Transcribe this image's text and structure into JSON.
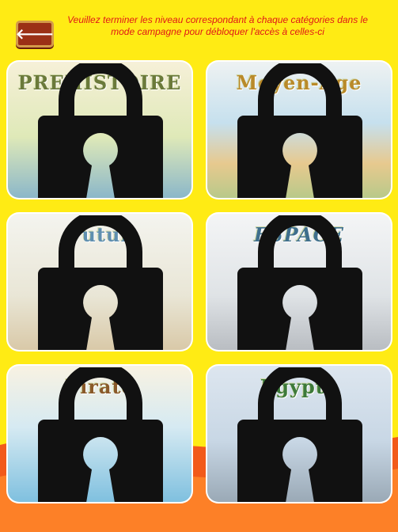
{
  "header": {
    "back_icon": "arrow-left-icon",
    "back_glyph": "🡐",
    "notice": "Veuillez terminer les niveau correspondant à chaque catégories dans le mode campagne pour débloquer l'accès à celles-ci"
  },
  "categories": [
    {
      "title": "PREHISTOIRE",
      "locked": true
    },
    {
      "title": "Moyen-Age",
      "locked": true
    },
    {
      "title": "Futur",
      "locked": true
    },
    {
      "title": "ESPACE",
      "locked": true
    },
    {
      "title": "Pirate",
      "locked": true
    },
    {
      "title": "Egypte",
      "locked": true
    }
  ],
  "colors": {
    "background": "#ffeb14",
    "notice_text": "#e01818",
    "back_button": "#9b3016",
    "lock": "#111111",
    "wave": "#f25a1a"
  }
}
